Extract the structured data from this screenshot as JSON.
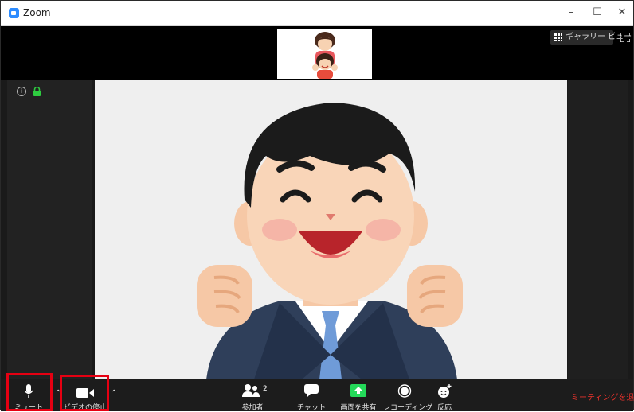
{
  "window": {
    "title": "Zoom"
  },
  "top": {
    "gallery_label": "ギャラリー ビュー"
  },
  "toolbar": {
    "mute": "ミュート",
    "stop_video": "ビデオの停止",
    "participants": "参加者",
    "participants_count": "2",
    "chat": "チャット",
    "share_screen": "画面を共有",
    "recording": "レコーディング",
    "reactions": "反応",
    "leave": "ミーティングを退出"
  },
  "colors": {
    "accent": "#2d8cff",
    "share_green": "#23d959",
    "leave_red": "#e5322c",
    "highlight": "#e60012"
  },
  "icons": [
    "zoom-logo-icon",
    "minimize-icon",
    "maximize-icon",
    "close-icon",
    "gallery-grid-icon",
    "fullscreen-icon",
    "info-icon",
    "lock-icon",
    "microphone-icon",
    "camera-icon",
    "participants-icon",
    "chat-icon",
    "share-screen-icon",
    "record-icon",
    "reaction-icon"
  ]
}
